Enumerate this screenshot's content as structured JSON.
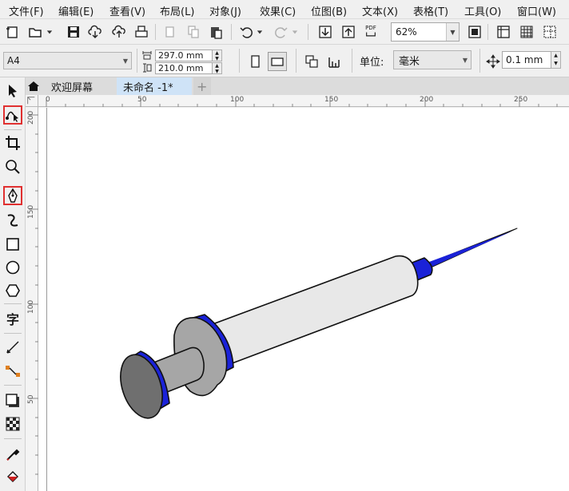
{
  "menu": [
    {
      "label": "文件(F)"
    },
    {
      "label": "编辑(E)"
    },
    {
      "label": "查看(V)"
    },
    {
      "label": "布局(L)"
    },
    {
      "label": "对象(J)"
    },
    {
      "label": "效果(C)"
    },
    {
      "label": "位图(B)"
    },
    {
      "label": "文本(X)"
    },
    {
      "label": "表格(T)"
    },
    {
      "label": "工具(O)"
    },
    {
      "label": "窗口(W)"
    }
  ],
  "toolbar": {
    "zoom_value": "62%",
    "pdf_label": "PDF"
  },
  "property_bar": {
    "page_size": "A4",
    "width": "297.0 mm",
    "height": "210.0 mm",
    "units_label": "单位:",
    "units_value": "毫米",
    "nudge": "0.1 mm"
  },
  "toolbox": {
    "text_tool_glyph": "字"
  },
  "tabs": [
    {
      "label": "欢迎屏幕"
    },
    {
      "label": "未命名 -1*"
    },
    {
      "label": "+"
    }
  ],
  "ruler": {
    "h_labels": [
      "0",
      "50",
      "100",
      "150",
      "200",
      "250"
    ],
    "v_labels": [
      "200",
      "150",
      "100",
      "50"
    ]
  },
  "colors": {
    "accent_blue": "#1a22d8",
    "barrel": "#e8e8e8",
    "plunger_gray": "#a6a6a6",
    "highlight_red": "#e03030"
  }
}
